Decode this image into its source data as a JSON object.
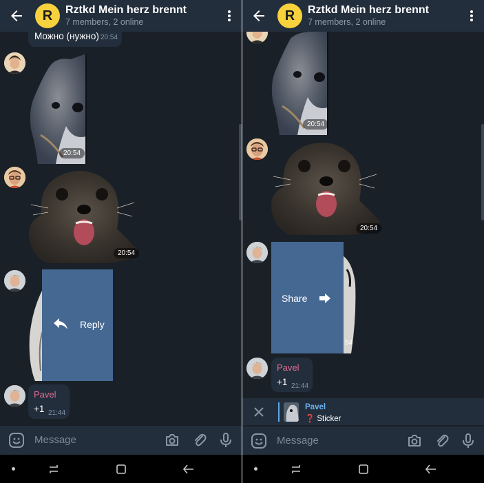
{
  "chat": {
    "title": "Rztkd Mein herz brennt",
    "subtitle": "7 members, 2 online",
    "avatar_letter": "R",
    "accent": "#f7d23d"
  },
  "left_panel": {
    "messages": {
      "top_text": "Можно (нужно)",
      "top_time": "20:54",
      "sticker1_time": "20:54",
      "sticker2_time": "20:54",
      "swipe_label": "Reply",
      "pavel_name": "Pavel",
      "pavel_text": "+1",
      "pavel_time": "21:44"
    }
  },
  "right_panel": {
    "messages": {
      "sticker1_time": "20:54",
      "sticker2_time": "20:54",
      "swipe_label": "Share",
      "swipe_time_fragment": "54",
      "pavel_name": "Pavel",
      "pavel_text": "+1",
      "pavel_time": "21:44"
    },
    "reply_preview": {
      "name": "Pavel",
      "icon": "❓",
      "text": "Sticker"
    }
  },
  "input": {
    "placeholder": "Message"
  },
  "icons": [
    "back-arrow-icon",
    "more-vert-icon",
    "sticker-icon",
    "camera-icon",
    "attach-icon",
    "mic-icon",
    "reply-icon",
    "share-arrow-icon",
    "close-icon",
    "recents-icon",
    "home-icon",
    "nav-back-icon"
  ],
  "colors": {
    "background": "#1a2027",
    "header": "#232e3c",
    "swipe": "#456892",
    "sender_name": "#df6d95",
    "link_blue": "#6ab3f3"
  }
}
